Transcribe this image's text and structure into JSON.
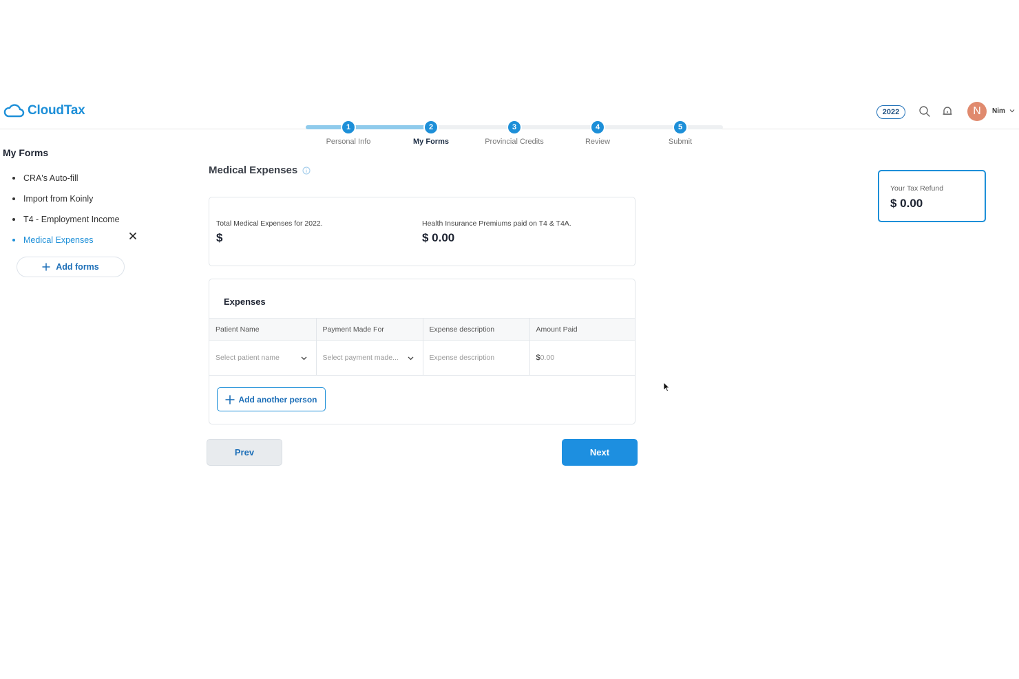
{
  "header": {
    "logo_text": "CloudTax",
    "year": "2022",
    "user": {
      "initial": "N",
      "name": "Nim"
    },
    "icons": [
      "cloud-logo-icon",
      "search-icon",
      "notification-icon",
      "chevron-down-icon"
    ]
  },
  "stepper": {
    "steps": [
      {
        "number": "1",
        "label": "Personal Info"
      },
      {
        "number": "2",
        "label": "My Forms"
      },
      {
        "number": "3",
        "label": "Provincial Credits"
      },
      {
        "number": "4",
        "label": "Review"
      },
      {
        "number": "5",
        "label": "Submit"
      }
    ],
    "active_step": 2
  },
  "sidebar": {
    "title": "My Forms",
    "items": [
      {
        "label": "CRA's Auto-fill"
      },
      {
        "label": "Import from Koinly"
      },
      {
        "label": "T4 - Employment Income"
      },
      {
        "label": "Medical Expenses",
        "active": true
      }
    ],
    "add_label": "Add forms"
  },
  "main": {
    "title": "Medical Expenses",
    "summary": {
      "total_label": "Total Medical Expenses for 2022.",
      "total_value": "$",
      "premiums_label": "Health Insurance Premiums paid on T4 & T4A.",
      "premiums_value": "$ 0.00"
    },
    "expenses": {
      "title": "Expenses",
      "columns": [
        "Patient Name",
        "Payment Made For",
        "Expense description",
        "Amount Paid"
      ],
      "row": {
        "patient_placeholder": "Select patient name",
        "payment_placeholder": "Select payment made...",
        "description_placeholder": "Expense description",
        "amount_prefix": "$",
        "amount_placeholder": "0.00"
      },
      "add_person_label": "Add another person"
    },
    "prev_label": "Prev",
    "next_label": "Next"
  },
  "refund": {
    "label": "Your Tax Refund",
    "value": "$ 0.00"
  },
  "colors": {
    "accent": "#1d8fd8",
    "accent_dark": "#1d6fb8",
    "progress_fill": "#8fcbec",
    "avatar": "#e08a6e"
  }
}
